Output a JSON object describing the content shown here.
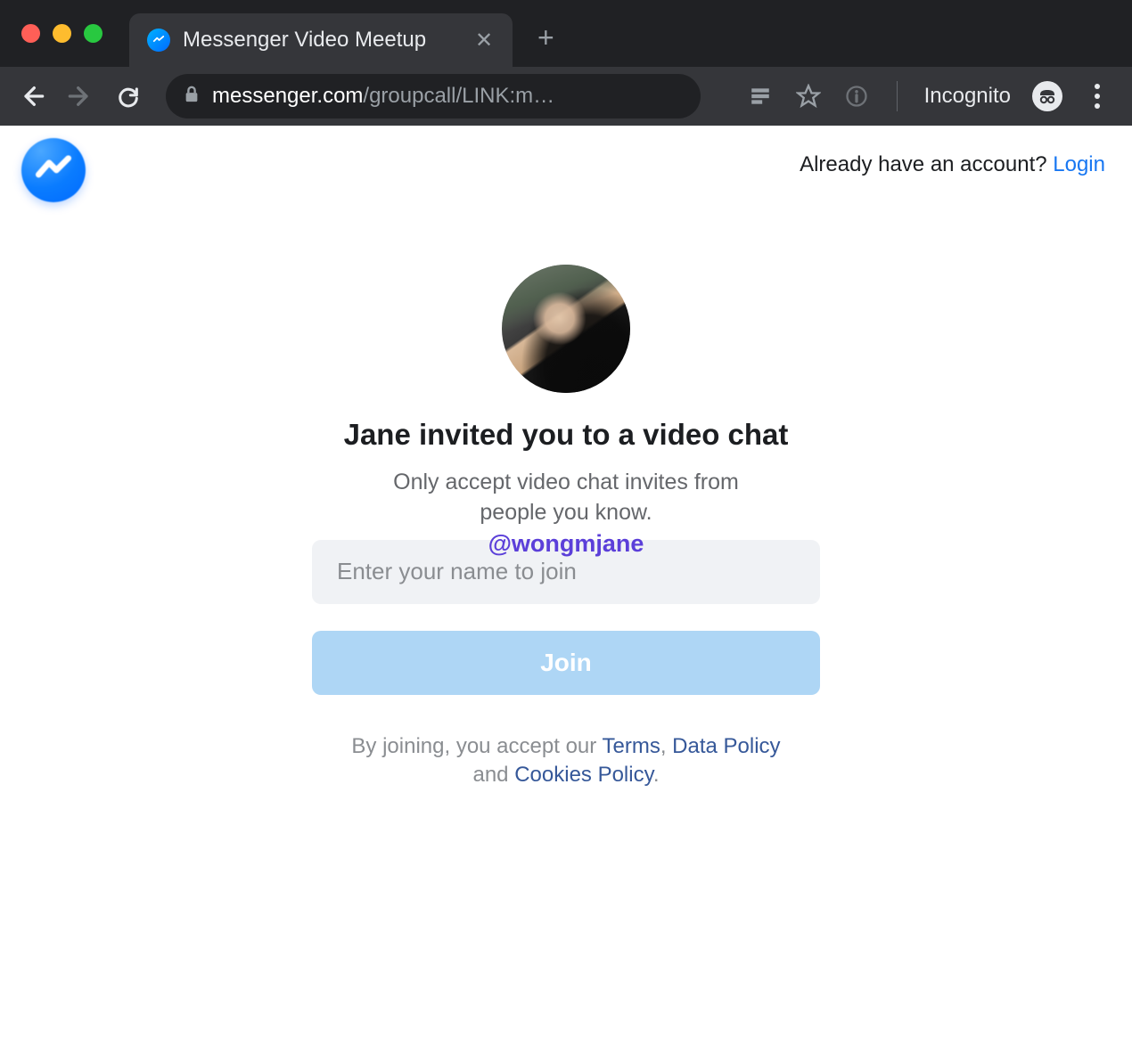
{
  "browser": {
    "tab_title": "Messenger Video Meetup",
    "url_host": "messenger.com",
    "url_path": "/groupcall/LINK:m…",
    "incognito_label": "Incognito"
  },
  "header": {
    "account_prompt": "Already have an account? ",
    "login_label": "Login"
  },
  "main": {
    "title": "Jane invited you to a video chat",
    "subtitle": "Only accept video chat invites from people you know.",
    "watermark": "@wongmjane",
    "name_placeholder": "Enter your name to join",
    "join_label": "Join"
  },
  "legal": {
    "prefix": "By joining, you accept our ",
    "terms": "Terms",
    "sep1": ", ",
    "data_policy": "Data Policy",
    "sep2": " and ",
    "cookies_policy": "Cookies Policy",
    "suffix": "."
  }
}
